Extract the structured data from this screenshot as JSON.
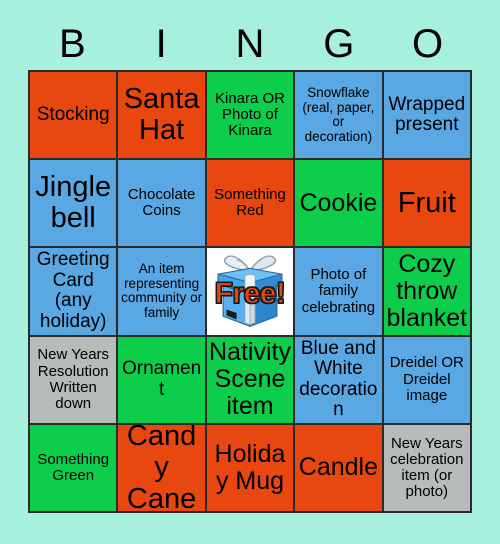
{
  "card": {
    "header_letters": [
      "B",
      "I",
      "N",
      "G",
      "O"
    ],
    "background_color": "#a7f0de",
    "grid_line_color": "#2b2b2b",
    "colors": {
      "red": "#e8470f",
      "green": "#0cce4a",
      "blue": "#59a7e3",
      "gray": "#b6bbbb",
      "free_background": "#ffffff",
      "free_text": "#e8470f"
    },
    "free_space": {
      "label": "Free!",
      "icon": "gift-box-icon"
    },
    "rows": [
      [
        {
          "text": "Stocking",
          "color": "red",
          "size": "md"
        },
        {
          "text": "Santa Hat",
          "color": "red",
          "size": "xl"
        },
        {
          "text": "Kinara OR Photo of Kinara",
          "color": "green",
          "size": "sm"
        },
        {
          "text": "Snowflake (real, paper, or decoration)",
          "color": "blue",
          "size": "xs"
        },
        {
          "text": "Wrapped present",
          "color": "blue",
          "size": "md"
        }
      ],
      [
        {
          "text": "Jingle bell",
          "color": "blue",
          "size": "xl"
        },
        {
          "text": "Chocolate Coins",
          "color": "blue",
          "size": "sm"
        },
        {
          "text": "Something Red",
          "color": "red",
          "size": "sm"
        },
        {
          "text": "Cookie",
          "color": "green",
          "size": "lg"
        },
        {
          "text": "Fruit",
          "color": "red",
          "size": "xl"
        }
      ],
      [
        {
          "text": "Greeting Card (any holiday)",
          "color": "blue",
          "size": "md"
        },
        {
          "text": "An item representing community or family",
          "color": "blue",
          "size": "xs"
        },
        {
          "text": "Free!",
          "color": "free",
          "size": "lg",
          "is_free": true
        },
        {
          "text": "Photo of family celebrating",
          "color": "blue",
          "size": "sm"
        },
        {
          "text": "Cozy throw blanket",
          "color": "green",
          "size": "lg"
        }
      ],
      [
        {
          "text": "New Years Resolution Written down",
          "color": "gray",
          "size": "sm"
        },
        {
          "text": "Ornament",
          "color": "green",
          "size": "md"
        },
        {
          "text": "Nativity Scene item",
          "color": "green",
          "size": "lg"
        },
        {
          "text": "Blue and White decoration",
          "color": "blue",
          "size": "md"
        },
        {
          "text": "Dreidel OR Dreidel image",
          "color": "blue",
          "size": "sm"
        }
      ],
      [
        {
          "text": "Something Green",
          "color": "green",
          "size": "sm"
        },
        {
          "text": "Candy Cane",
          "color": "red",
          "size": "xl"
        },
        {
          "text": "Holiday Mug",
          "color": "red",
          "size": "lg"
        },
        {
          "text": "Candle",
          "color": "red",
          "size": "lg"
        },
        {
          "text": "New Years celebration item (or photo)",
          "color": "gray",
          "size": "sm"
        }
      ]
    ]
  }
}
